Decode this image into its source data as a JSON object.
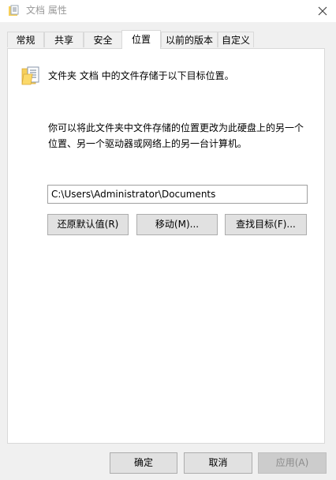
{
  "window": {
    "title": "文档 属性",
    "close_glyph": "✕"
  },
  "tabs": [
    {
      "label": "常规",
      "active": false
    },
    {
      "label": "共享",
      "active": false
    },
    {
      "label": "安全",
      "active": false
    },
    {
      "label": "位置",
      "active": true
    },
    {
      "label": "以前的版本",
      "active": false
    },
    {
      "label": "自定义",
      "active": false
    }
  ],
  "location": {
    "header": "文件夹 文档 中的文件存储于以下目标位置。",
    "description_line1": "你可以将此文件夹中文件存储的位置更改为此硬盘上的另一个",
    "description_line2": "位置、另一个驱动器或网络上的另一台计算机。",
    "path_value": "C:\\Users\\Administrator\\Documents",
    "restore_default_label": "还原默认值(R)",
    "move_label": "移动(M)...",
    "find_target_label": "查找目标(F)..."
  },
  "footer": {
    "ok_label": "确定",
    "cancel_label": "取消",
    "apply_label": "应用(A)"
  },
  "colors": {
    "folder_yellow": "#f6cf5a",
    "title_text": "#999999",
    "border": "#d9d9d9"
  }
}
